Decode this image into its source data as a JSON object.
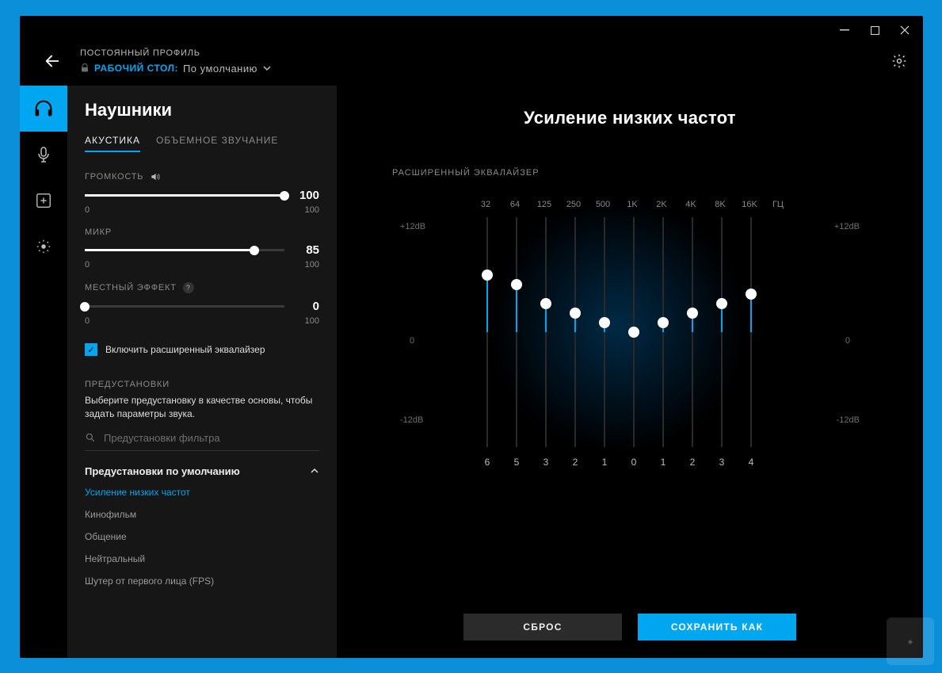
{
  "header": {
    "subtitle": "ПОСТОЯННЫЙ ПРОФИЛЬ",
    "profile_link": "РАБОЧИЙ СТОЛ:",
    "profile_rest": "По умолчанию"
  },
  "panel": {
    "title": "Наушники",
    "tabs": {
      "acoustics": "АКУСТИКА",
      "surround": "ОБЪЕМНОЕ ЗВУЧАНИЕ"
    },
    "volume": {
      "label": "ГРОМКОСТЬ",
      "value": "100",
      "min": "0",
      "max": "100"
    },
    "mic": {
      "label": "МИКР",
      "value": "85",
      "min": "0",
      "max": "100"
    },
    "local": {
      "label": "МЕСТНЫЙ ЭФФЕКТ",
      "value": "0",
      "min": "0",
      "max": "100"
    },
    "checkbox": "Включить расширенный эквалайзер",
    "presets_label": "ПРЕДУСТАНОВКИ",
    "hint": "Выберите предустановку в качестве основы, чтобы задать параметры звука.",
    "search_placeholder": "Предустановки фильтра",
    "preset_header": "Предустановки по умолчанию",
    "presets": [
      "Усиление низких частот",
      "Кинофильм",
      "Общение",
      "Нейтральный",
      "Шутер от первого лица (FPS)"
    ]
  },
  "main": {
    "title": "Усиление низких частот",
    "eq_label": "РАСШИРЕННЫЙ ЭКВАЛАЙЗЕР",
    "hz_label": "ГЦ",
    "db_top": "+12dB",
    "db_bot": "-12dB",
    "zero": "0",
    "freqs": [
      "32",
      "64",
      "125",
      "250",
      "500",
      "1K",
      "2K",
      "4K",
      "8K",
      "16K"
    ],
    "values": [
      6,
      5,
      3,
      2,
      1,
      0,
      1,
      2,
      3,
      4
    ],
    "reset": "СБРОС",
    "save": "СОХРАНИТЬ КАК"
  }
}
